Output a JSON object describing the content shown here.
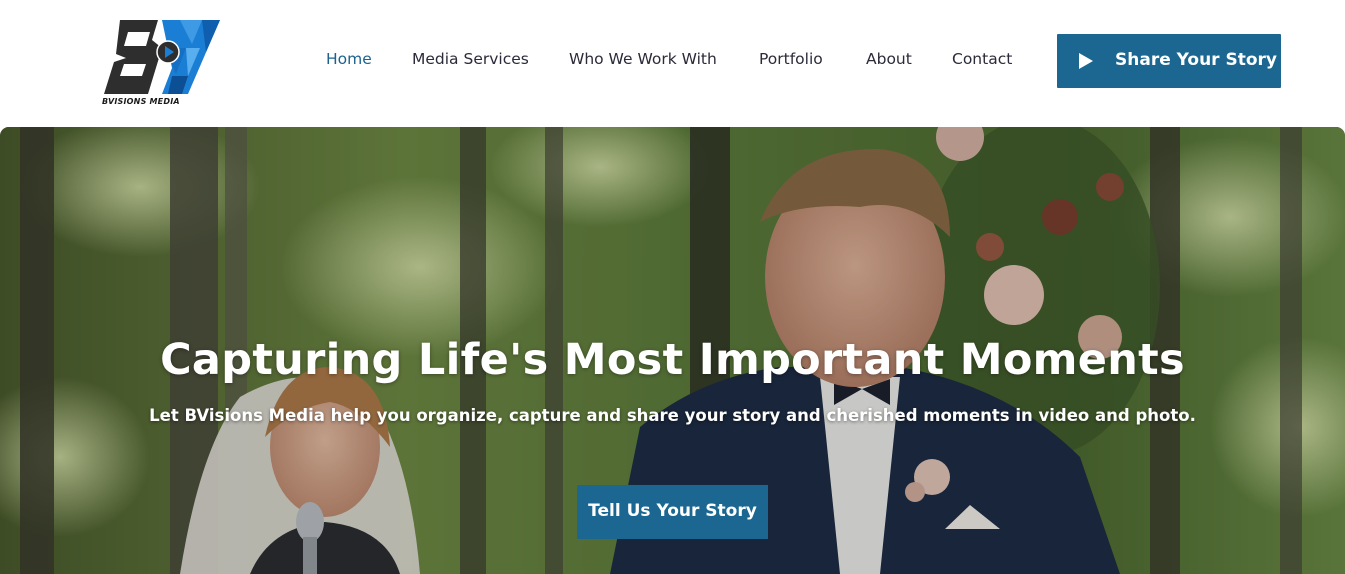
{
  "brand": {
    "logo_text": "BVISIONS MEDIA",
    "colors": {
      "primary": "#1b6792",
      "nav_active": "#1d628f",
      "nav_text": "#2b2b3a",
      "logo_dark": "#2d2d2d",
      "logo_blue": "#1a7fd4"
    }
  },
  "nav": {
    "items": [
      {
        "label": "Home",
        "active": true
      },
      {
        "label": "Media Services",
        "active": false
      },
      {
        "label": "Who We Work With",
        "active": false
      },
      {
        "label": "Portfolio",
        "active": false
      },
      {
        "label": "About",
        "active": false
      },
      {
        "label": "Contact",
        "active": false
      }
    ],
    "cta": {
      "label": "Share Your Story",
      "icon": "play-icon"
    }
  },
  "hero": {
    "title": "Capturing Life's Most Important Moments",
    "subtitle": "Let BVisions Media help you organize, capture and share your story and cherished moments in video and photo.",
    "button_label": "Tell Us Your Story",
    "background": "wedding-ceremony-photo"
  }
}
